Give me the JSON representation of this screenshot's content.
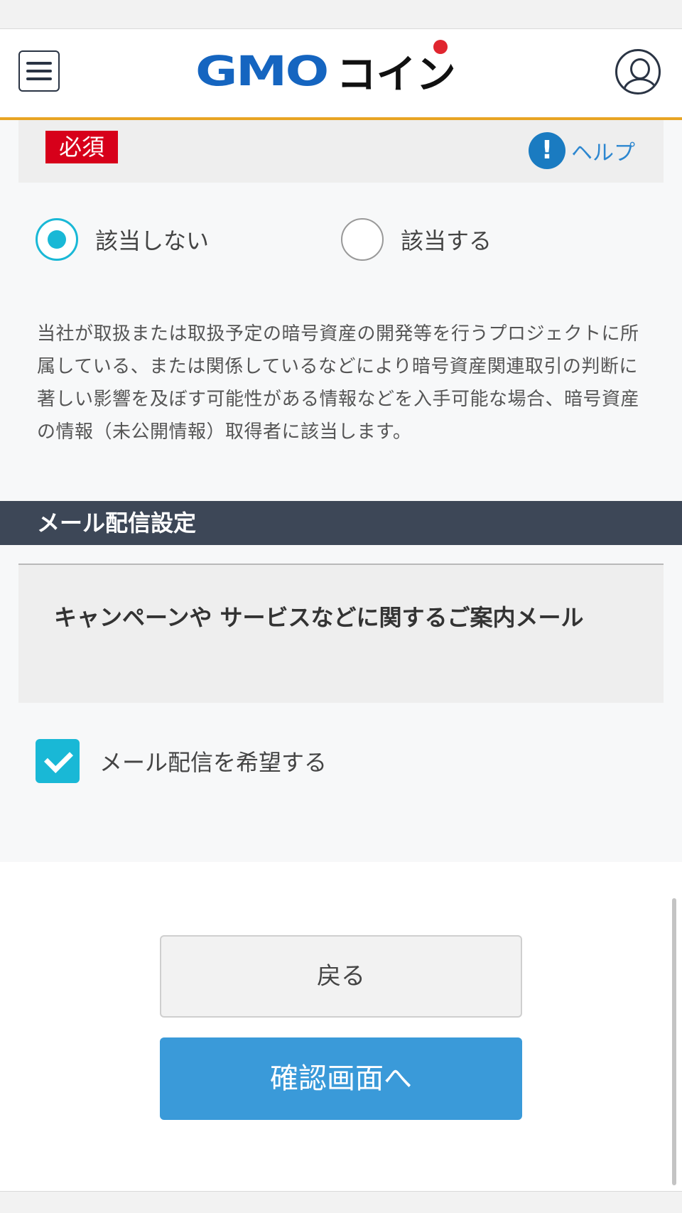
{
  "header": {
    "logo_gmo": "GMO",
    "logo_coin": "コイン"
  },
  "question": {
    "required_badge": "必須",
    "help_icon": "!",
    "help_label": "ヘルプ",
    "options": [
      {
        "label": "該当しない",
        "selected": true
      },
      {
        "label": "該当する",
        "selected": false
      }
    ],
    "description": "当社が取扱または取扱予定の暗号資産の開発等を行うプロジェクトに所属している、または関係しているなどにより暗号資産関連取引の判断に著しい影響を及ぼす可能性がある情報などを入手可能な場合、暗号資産の情報（未公開情報）取得者に該当します。"
  },
  "mail_section": {
    "title": "メール配信設定",
    "card_title": "キャンペーンや サービスなどに関するご案内メール",
    "checkbox_label": "メール配信を希望する",
    "checkbox_checked": true
  },
  "buttons": {
    "back": "戻る",
    "confirm": "確認画面へ"
  },
  "colors": {
    "accent_orange": "#e8a424",
    "brand_blue": "#1565c0",
    "teal": "#19b8d6",
    "confirm_blue": "#3a9ad9",
    "required_red": "#d7001a",
    "section_dark": "#3d4757"
  }
}
